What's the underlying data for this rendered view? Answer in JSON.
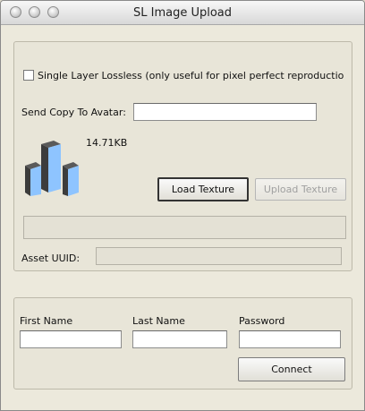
{
  "window": {
    "title": "SL Image Upload"
  },
  "options": {
    "lossless_label": "Single Layer Lossless (only useful for pixel perfect reproductio",
    "lossless_checked": false,
    "send_copy_label": "Send Copy To Avatar:",
    "send_copy_value": ""
  },
  "texture": {
    "size_text": "14.71KB",
    "load_button": "Load Texture",
    "upload_button": "Upload Texture",
    "progress_value": "",
    "asset_uuid_label": "Asset UUID:",
    "asset_uuid_value": ""
  },
  "login": {
    "first_name_label": "First Name",
    "first_name_value": "",
    "last_name_label": "Last Name",
    "last_name_value": "",
    "password_label": "Password",
    "password_value": "",
    "connect_button": "Connect"
  },
  "colors": {
    "icon_blue": "#8ec4ff",
    "icon_dark": "#3c3c3c"
  }
}
